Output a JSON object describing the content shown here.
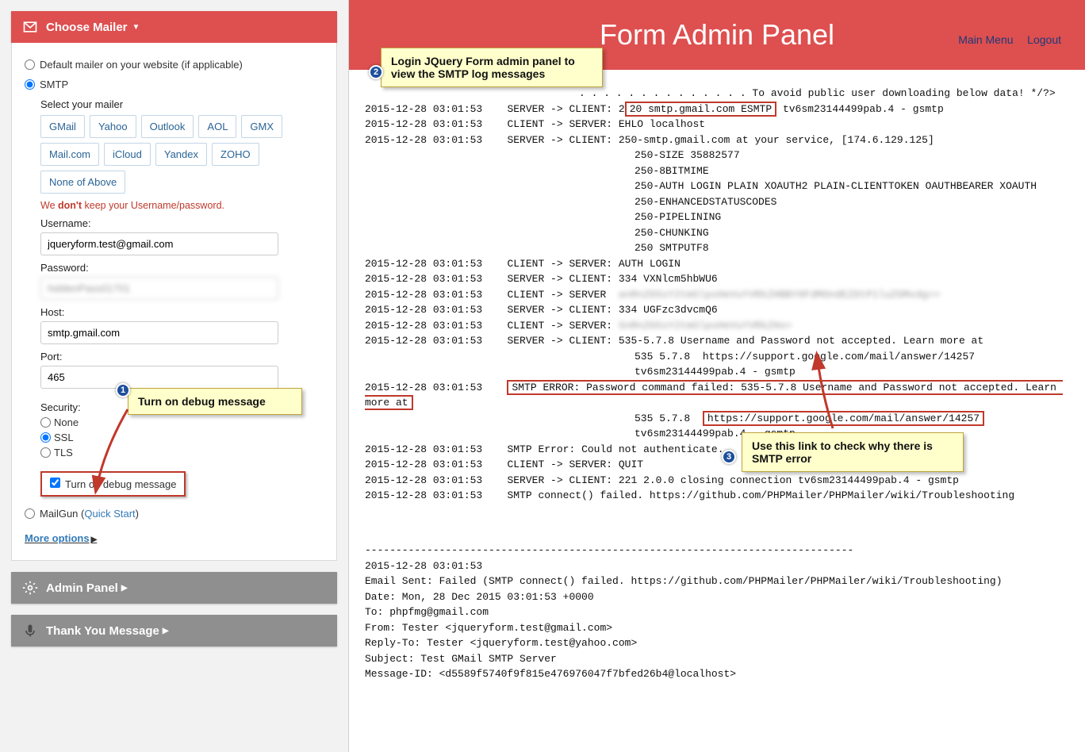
{
  "left": {
    "choose_mailer": {
      "title": "Choose Mailer"
    },
    "radios": {
      "default_label": "Default mailer on your website (if applicable)",
      "smtp_label": "SMTP",
      "mailgun_label": "MailGun (",
      "quick_start_label": "Quick Start",
      "mailgun_close": ")"
    },
    "select_mailer_label": "Select your mailer",
    "mailer_buttons": [
      "GMail",
      "Yahoo",
      "Outlook",
      "AOL",
      "GMX",
      "Mail.com",
      "iCloud",
      "Yandex",
      "ZOHO",
      "None of Above"
    ],
    "warn_prefix": "We ",
    "warn_bold": "don't",
    "warn_suffix": " keep your Username/password.",
    "labels": {
      "username": "Username:",
      "password": "Password:",
      "host": "Host:",
      "port": "Port:",
      "security": "Security:"
    },
    "values": {
      "username": "jqueryform.test@gmail.com",
      "password": "hiddenPass01701",
      "host": "smtp.gmail.com",
      "port": "465"
    },
    "security_options": {
      "none": "None",
      "ssl": "SSL",
      "tls": "TLS"
    },
    "debug_label": "Turn on debug message",
    "more_options": "More options",
    "admin_panel_title": "Admin Panel",
    "thank_you_title": "Thank You Message"
  },
  "callouts": {
    "c1": "Turn on debug message",
    "c2": "Login JQuery Form admin panel to view the SMTP log messages",
    "c3": "Use this link to check why there is SMTP error"
  },
  "right": {
    "title": "Form Admin Panel",
    "links": {
      "main": "Main Menu",
      "logout": "Logout"
    },
    "log": {
      "l0": ". . . . . . . . . . . . . . To avoid public user downloading below data! */?>",
      "ts": "2015-12-28 03:01:53",
      "l1a": "SERVER -> CLIENT: 2",
      "l1_hl": "20 smtp.gmail.com ESMTP",
      "l1b": "tv6sm23144499pab.4 - gsmtp",
      "l2": "CLIENT -> SERVER: EHLO localhost",
      "l3": "SERVER -> CLIENT: 250-smtp.gmail.com at your service, [174.6.129.125]",
      "l3b": "250-SIZE 35882577",
      "l3c": "250-8BITMIME",
      "l3d": "250-AUTH LOGIN PLAIN XOAUTH2 PLAIN-CLIENTTOKEN OAUTHBEARER XOAUTH",
      "l3e": "250-ENHANCEDSTATUSCODES",
      "l3f": "250-PIPELINING",
      "l3g": "250-CHUNKING",
      "l3h": "250 SMTPUTF8",
      "l4": "CLIENT -> SERVER: AUTH LOGIN",
      "l5": "SERVER -> CLIENT: 334 VXNlcm5hbWU6",
      "l6": "CLIENT -> SERVER",
      "l7": "SERVER -> CLIENT: 334 UGFzc3dvcmQ6",
      "l8": "CLIENT -> SERVER:",
      "l9": "SERVER -> CLIENT: 535-5.7.8 Username and Password not accepted. Learn more at",
      "l9b": "535 5.7.8  https://support.google.com/mail/answer/14257 tv6sm23144499pab.4 - gsmtp",
      "l10_hl": "SMTP ERROR: Password command failed: 535-5.7.8 Username and Password not accepted. Learn more at",
      "l10b_a": "535 5.7.8  ",
      "l10b_hl": "https://support.google.com/mail/answer/14257",
      "l10b_b": "tv6sm23144499pab.4 - gsmtp",
      "l11": "SMTP Error: Could not authenticate.",
      "l12": "CLIENT -> SERVER: QUIT",
      "l13": "SERVER -> CLIENT: 221 2.0.0 closing connection tv6sm23144499pab.4 - gsmtp",
      "l14": "SMTP connect() failed. https://github.com/PHPMailer/PHPMailer/wiki/Troubleshooting",
      "sep": "-------------------------------------------------------------------------------",
      "f1": "2015-12-28 03:01:53",
      "f2": "Email Sent: Failed (SMTP connect() failed. https://github.com/PHPMailer/PHPMailer/wiki/Troubleshooting)",
      "f3": "Date: Mon, 28 Dec 2015 03:01:53 +0000",
      "f4": "To: phpfmg@gmail.com",
      "f5": "From: Tester <jqueryform.test@gmail.com>",
      "f6": "Reply-To: Tester <jqueryform.test@yahoo.com>",
      "f7": "Subject: Test GMail SMTP Server",
      "f8": "Message-ID: <d5589f5740f9f815e476976047f7bfed26b4@localhost>"
    }
  }
}
